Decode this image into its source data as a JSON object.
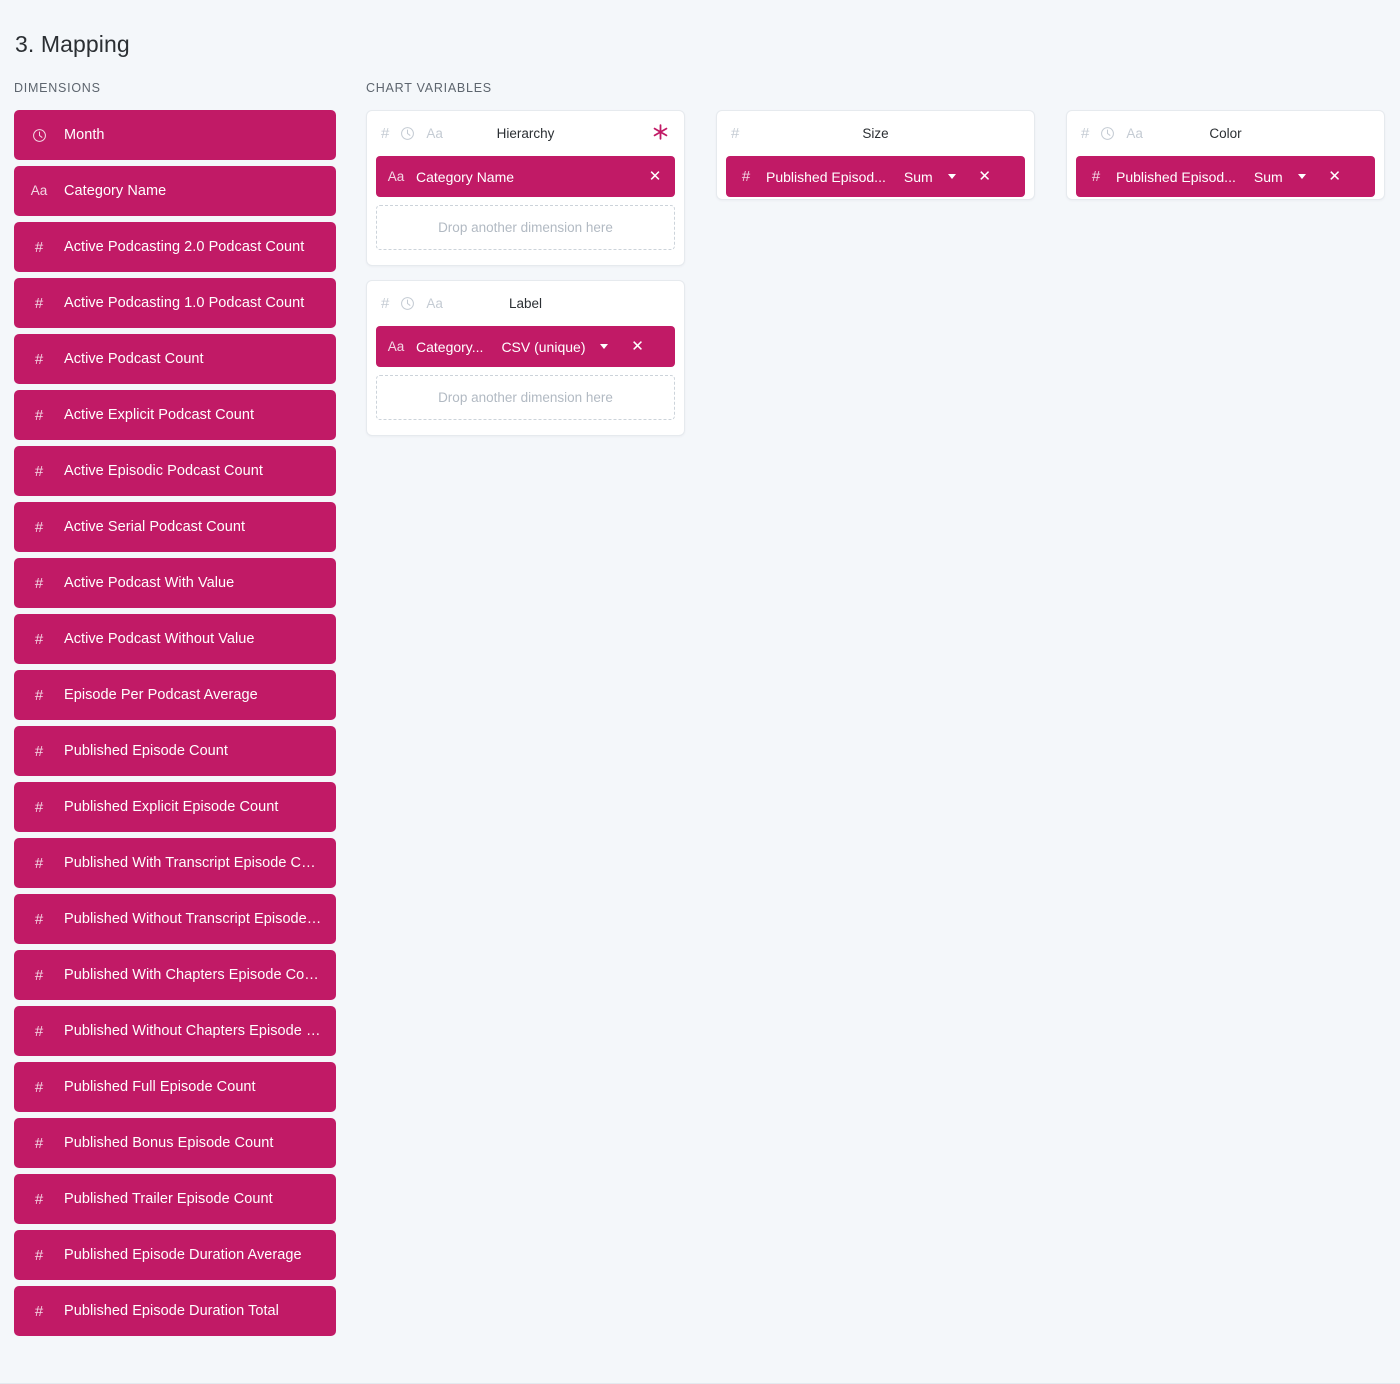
{
  "page": {
    "title": "3. Mapping",
    "dimensions_label": "DIMENSIONS",
    "chart_variables_label": "CHART VARIABLES",
    "accent_color": "#c11a66",
    "background_color": "#f4f7fa",
    "card_background": "#ffffff"
  },
  "dimensions": {
    "items": [
      {
        "icon": "clock-icon",
        "label": "Month"
      },
      {
        "icon": "text-aa-icon",
        "label": "Category Name"
      },
      {
        "icon": "hash-icon",
        "label": "Active Podcasting 2.0 Podcast Count"
      },
      {
        "icon": "hash-icon",
        "label": "Active Podcasting 1.0 Podcast Count"
      },
      {
        "icon": "hash-icon",
        "label": "Active Podcast Count"
      },
      {
        "icon": "hash-icon",
        "label": "Active Explicit Podcast Count"
      },
      {
        "icon": "hash-icon",
        "label": "Active Episodic Podcast Count"
      },
      {
        "icon": "hash-icon",
        "label": "Active Serial Podcast Count"
      },
      {
        "icon": "hash-icon",
        "label": "Active Podcast With Value"
      },
      {
        "icon": "hash-icon",
        "label": "Active Podcast Without Value"
      },
      {
        "icon": "hash-icon",
        "label": "Episode Per Podcast Average"
      },
      {
        "icon": "hash-icon",
        "label": "Published Episode Count"
      },
      {
        "icon": "hash-icon",
        "label": "Published Explicit Episode Count"
      },
      {
        "icon": "hash-icon",
        "label": "Published With Transcript Episode Count"
      },
      {
        "icon": "hash-icon",
        "label": "Published Without Transcript Episode C..."
      },
      {
        "icon": "hash-icon",
        "label": "Published With Chapters Episode Count"
      },
      {
        "icon": "hash-icon",
        "label": "Published Without Chapters Episode Co..."
      },
      {
        "icon": "hash-icon",
        "label": "Published Full Episode Count"
      },
      {
        "icon": "hash-icon",
        "label": "Published Bonus Episode Count"
      },
      {
        "icon": "hash-icon",
        "label": "Published Trailer Episode Count"
      },
      {
        "icon": "hash-icon",
        "label": "Published Episode Duration Average"
      },
      {
        "icon": "hash-icon",
        "label": "Published Episode Duration Total"
      }
    ]
  },
  "chart_variables": {
    "drop_placeholder": "Drop another dimension here",
    "hierarchy": {
      "title": "Hierarchy",
      "accepted_types": [
        "hash-icon",
        "clock-icon",
        "text-aa-icon"
      ],
      "required_marker": "✳",
      "required": true,
      "chip": {
        "icon": "text-aa-icon",
        "name": "Category Name",
        "aggregation": null,
        "close": "✕"
      }
    },
    "label": {
      "title": "Label",
      "accepted_types": [
        "hash-icon",
        "clock-icon",
        "text-aa-icon"
      ],
      "required": false,
      "chip": {
        "icon": "text-aa-icon",
        "name": "Category...",
        "aggregation": "CSV (unique)",
        "close": "✕"
      }
    },
    "size": {
      "title": "Size",
      "accepted_types": [
        "hash-icon"
      ],
      "required": false,
      "chip": {
        "icon": "hash-icon",
        "name": "Published Episod...",
        "aggregation": "Sum",
        "close": "✕"
      }
    },
    "color": {
      "title": "Color",
      "accepted_types": [
        "hash-icon",
        "clock-icon",
        "text-aa-icon"
      ],
      "required": false,
      "chip": {
        "icon": "hash-icon",
        "name": "Published Episod...",
        "aggregation": "Sum",
        "close": "✕"
      }
    }
  }
}
